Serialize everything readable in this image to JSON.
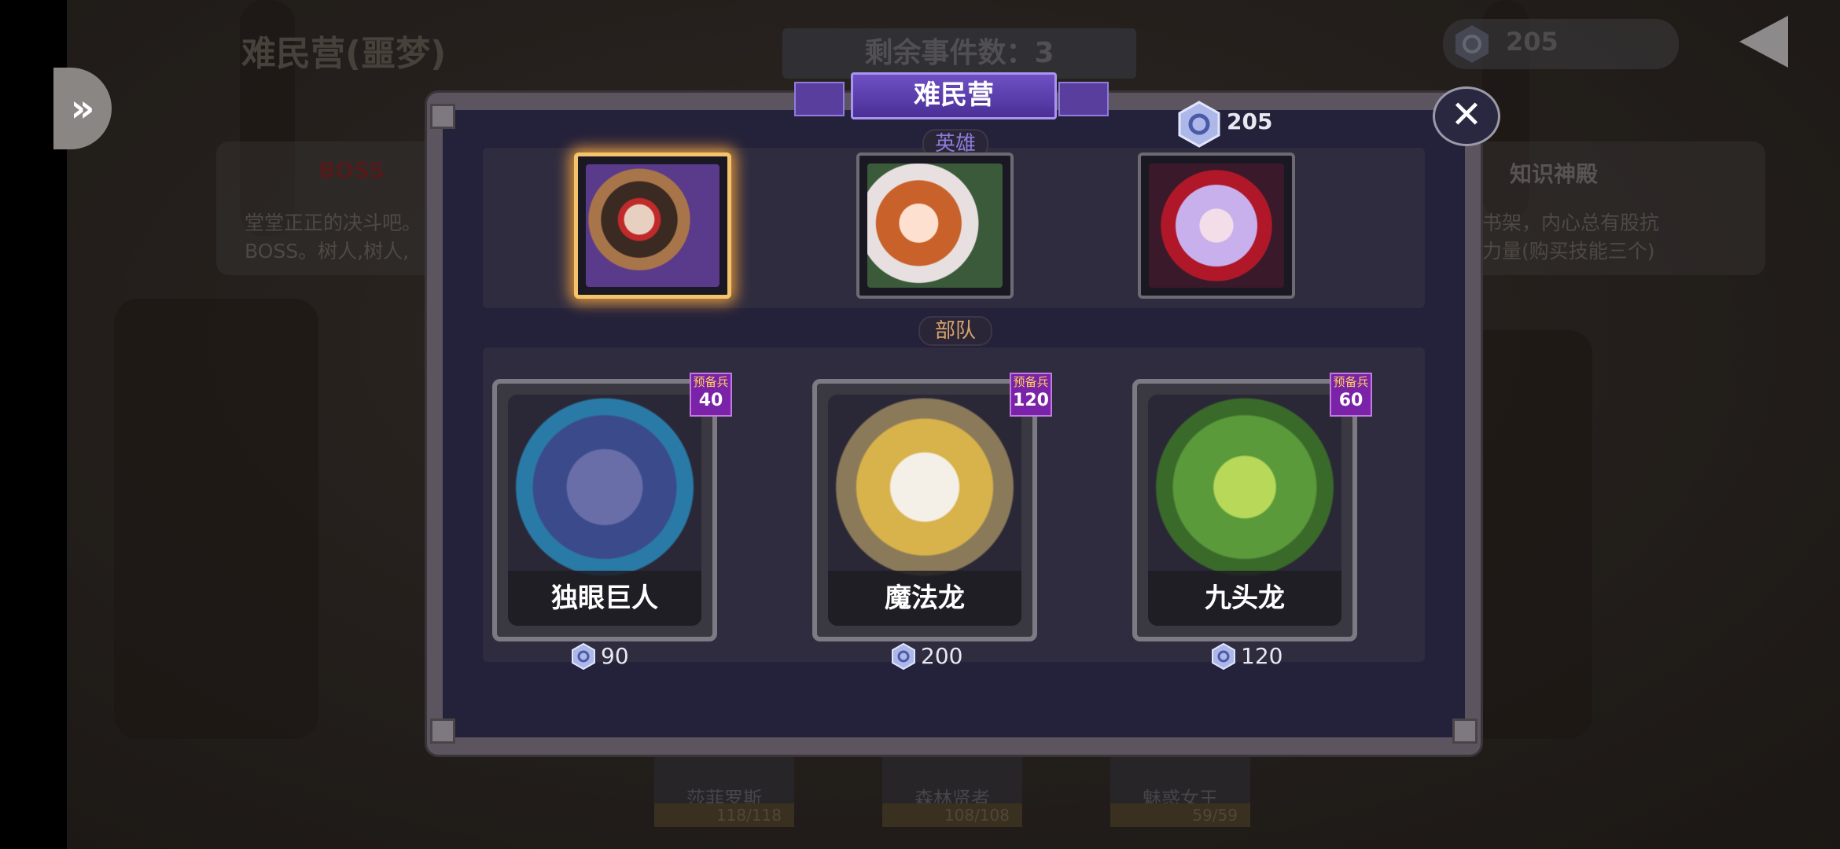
{
  "background": {
    "location_title": "难民营(噩梦)",
    "events_remaining": "剩余事件数：3",
    "gem_total": "205",
    "left_node": {
      "label": "BOSS",
      "desc_lines": [
        "堂堂正正的决斗吧。",
        "BOSS。树人,树人,"
      ]
    },
    "right_node": {
      "label": "知识神殿",
      "desc_lines": [
        "书架，内心总有股抗",
        "力量(购买技能三个)"
      ]
    },
    "bottom_heroes": [
      {
        "name": "莎菲罗斯",
        "hp": "118/118"
      },
      {
        "name": "森林贤者",
        "hp": "108/108"
      },
      {
        "name": "魅惑女王",
        "hp": "59/59"
      }
    ]
  },
  "dialog": {
    "title": "难民营",
    "gems": "205",
    "close_label": "✕",
    "hero_section_label": "英雄",
    "troop_section_label": "部队",
    "heroes": [
      {
        "id": "hero-cyclops-eye",
        "selected": true
      },
      {
        "id": "hero-redhair-girl",
        "selected": false
      },
      {
        "id": "hero-horned-girl",
        "selected": false
      }
    ],
    "troops": [
      {
        "name": "独眼巨人",
        "reserve_label": "预备兵",
        "reserve_count": "40",
        "price": "90"
      },
      {
        "name": "魔法龙",
        "reserve_label": "预备兵",
        "reserve_count": "120",
        "price": "200"
      },
      {
        "name": "九头龙",
        "reserve_label": "预备兵",
        "reserve_count": "60",
        "price": "120"
      }
    ]
  },
  "colors": {
    "accent_purple": "#6e50c4",
    "selected_glow": "#f5c46a",
    "reserve_badge": "#7a22a8"
  }
}
